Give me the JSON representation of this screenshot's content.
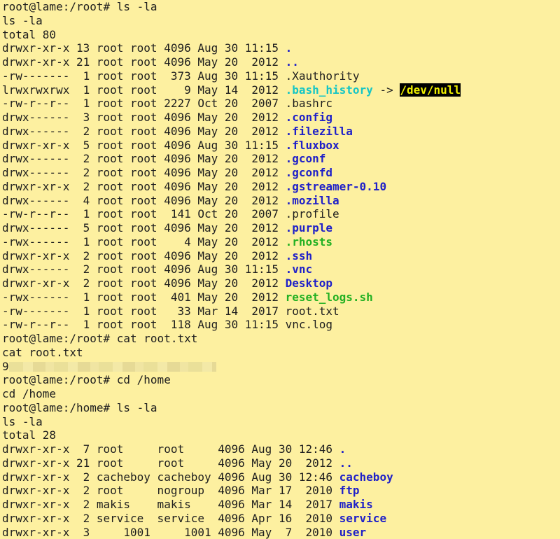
{
  "colors": {
    "background": "#fdf0a0",
    "text": "#1e1e1e",
    "directory": "#1f20c8",
    "symlink": "#15c5c5",
    "executable": "#22b022",
    "highlight_bg": "#000000",
    "highlight_fg": "#f0f000"
  },
  "terminal": {
    "lines": [
      {
        "type": "plain",
        "text": "root@lame:/root# ls -la"
      },
      {
        "type": "plain",
        "text": "ls -la"
      },
      {
        "type": "plain",
        "text": "total 80"
      },
      {
        "type": "entry",
        "meta": "drwxr-xr-x 13 root root 4096 Aug 30 11:15 ",
        "name": ".",
        "kind": "dir"
      },
      {
        "type": "entry",
        "meta": "drwxr-xr-x 21 root root 4096 May 20  2012 ",
        "name": "..",
        "kind": "dir"
      },
      {
        "type": "entry",
        "meta": "-rw-------  1 root root  373 Aug 30 11:15 ",
        "name": ".Xauthority",
        "kind": "file"
      },
      {
        "type": "symlink",
        "meta": "lrwxrwxrwx  1 root root    9 May 14  2012 ",
        "name": ".bash_history",
        "arrow": " -> ",
        "target": "/dev/null"
      },
      {
        "type": "entry",
        "meta": "-rw-r--r--  1 root root 2227 Oct 20  2007 ",
        "name": ".bashrc",
        "kind": "file"
      },
      {
        "type": "entry",
        "meta": "drwx------  3 root root 4096 May 20  2012 ",
        "name": ".config",
        "kind": "dir"
      },
      {
        "type": "entry",
        "meta": "drwx------  2 root root 4096 May 20  2012 ",
        "name": ".filezilla",
        "kind": "dir"
      },
      {
        "type": "entry",
        "meta": "drwxr-xr-x  5 root root 4096 Aug 30 11:15 ",
        "name": ".fluxbox",
        "kind": "dir"
      },
      {
        "type": "entry",
        "meta": "drwx------  2 root root 4096 May 20  2012 ",
        "name": ".gconf",
        "kind": "dir"
      },
      {
        "type": "entry",
        "meta": "drwx------  2 root root 4096 May 20  2012 ",
        "name": ".gconfd",
        "kind": "dir"
      },
      {
        "type": "entry",
        "meta": "drwxr-xr-x  2 root root 4096 May 20  2012 ",
        "name": ".gstreamer-0.10",
        "kind": "dir"
      },
      {
        "type": "entry",
        "meta": "drwx------  4 root root 4096 May 20  2012 ",
        "name": ".mozilla",
        "kind": "dir"
      },
      {
        "type": "entry",
        "meta": "-rw-r--r--  1 root root  141 Oct 20  2007 ",
        "name": ".profile",
        "kind": "file"
      },
      {
        "type": "entry",
        "meta": "drwx------  5 root root 4096 May 20  2012 ",
        "name": ".purple",
        "kind": "dir"
      },
      {
        "type": "entry",
        "meta": "-rwx------  1 root root    4 May 20  2012 ",
        "name": ".rhosts",
        "kind": "exe"
      },
      {
        "type": "entry",
        "meta": "drwxr-xr-x  2 root root 4096 May 20  2012 ",
        "name": ".ssh",
        "kind": "dir"
      },
      {
        "type": "entry",
        "meta": "drwx------  2 root root 4096 Aug 30 11:15 ",
        "name": ".vnc",
        "kind": "dir"
      },
      {
        "type": "entry",
        "meta": "drwxr-xr-x  2 root root 4096 May 20  2012 ",
        "name": "Desktop",
        "kind": "dir"
      },
      {
        "type": "entry",
        "meta": "-rwx------  1 root root  401 May 20  2012 ",
        "name": "reset_logs.sh",
        "kind": "exe"
      },
      {
        "type": "entry",
        "meta": "-rw-------  1 root root   33 Mar 14  2017 ",
        "name": "root.txt",
        "kind": "file"
      },
      {
        "type": "entry",
        "meta": "-rw-r--r--  1 root root  118 Aug 30 11:15 ",
        "name": "vnc.log",
        "kind": "file"
      },
      {
        "type": "plain",
        "text": "root@lame:/root# cat root.txt"
      },
      {
        "type": "plain",
        "text": "cat root.txt"
      },
      {
        "type": "redacted",
        "text": "9"
      },
      {
        "type": "plain",
        "text": "root@lame:/root# cd /home"
      },
      {
        "type": "plain",
        "text": "cd /home"
      },
      {
        "type": "plain",
        "text": "root@lame:/home# ls -la"
      },
      {
        "type": "plain",
        "text": "ls -la"
      },
      {
        "type": "plain",
        "text": "total 28"
      },
      {
        "type": "entry",
        "meta": "drwxr-xr-x  7 root     root     4096 Aug 30 12:46 ",
        "name": ".",
        "kind": "dir"
      },
      {
        "type": "entry",
        "meta": "drwxr-xr-x 21 root     root     4096 May 20  2012 ",
        "name": "..",
        "kind": "dir"
      },
      {
        "type": "entry",
        "meta": "drwxr-xr-x  2 cacheboy cacheboy 4096 Aug 30 12:46 ",
        "name": "cacheboy",
        "kind": "dir"
      },
      {
        "type": "entry",
        "meta": "drwxr-xr-x  2 root     nogroup  4096 Mar 17  2010 ",
        "name": "ftp",
        "kind": "dir"
      },
      {
        "type": "entry",
        "meta": "drwxr-xr-x  2 makis    makis    4096 Mar 14  2017 ",
        "name": "makis",
        "kind": "dir"
      },
      {
        "type": "entry",
        "meta": "drwxr-xr-x  2 service  service  4096 Apr 16  2010 ",
        "name": "service",
        "kind": "dir"
      },
      {
        "type": "entry",
        "meta": "drwxr-xr-x  3     1001     1001 4096 May  7  2010 ",
        "name": "user",
        "kind": "dir"
      }
    ]
  }
}
